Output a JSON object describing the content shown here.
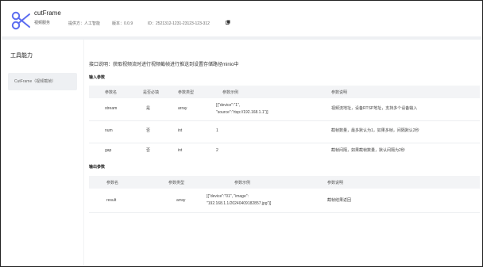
{
  "tool": {
    "name": "cutFrame",
    "subtitle": "视频服务",
    "provider_label": "提供方：",
    "provider_value": "人工智能",
    "version_label": "版本：",
    "version_value": "0.0.9",
    "id_label": "ID：",
    "id_value": "2521312-1231-23123-123-312"
  },
  "nav": {
    "section_title": "工具能力",
    "items": [
      {
        "label": "CutFrame（视频截帧）"
      }
    ]
  },
  "main": {
    "description": "接口说明：获取视频流时进行视频截帧进行推送到设置存储路径minio中",
    "input_title": "输入参数",
    "input_headers": [
      "参数名",
      "是否必填",
      "参数类型",
      "参数示例",
      "参数说明"
    ],
    "input_rows": [
      {
        "name": "stream",
        "required": "是",
        "type": "array",
        "example_l1": "[{\"device\":\"1\",",
        "example_l2": "\"source\":\"rtsp://192.168.1.1\"}]",
        "desc": "视频流地址，设备RTSP地址，支持多个设备输入"
      },
      {
        "name": "num",
        "required": "否",
        "type": "int",
        "example_l1": "1",
        "example_l2": "",
        "desc": "截帧数量，最多默认为1，如果多帧，间隔默认2秒"
      },
      {
        "name": "gap",
        "required": "否",
        "type": "int",
        "example_l1": "2",
        "example_l2": "",
        "desc": "截帧间隔，如果截帧数量，默认间隔为2秒"
      }
    ],
    "output_title": "输出参数",
    "output_headers": [
      "参数名",
      "参数类型",
      "参数示例",
      "参数说明"
    ],
    "output_rows": [
      {
        "name": "result",
        "type": "array",
        "example_l1": "[{\"device\":\"01\", \"image\":",
        "example_l2": "\"192.168.1.1/20240409182857.jpg\"}]",
        "desc": "截帧结果返回"
      }
    ]
  },
  "colors": {
    "accent": "#5b6cf0",
    "header_bar": "#eef0f3"
  }
}
